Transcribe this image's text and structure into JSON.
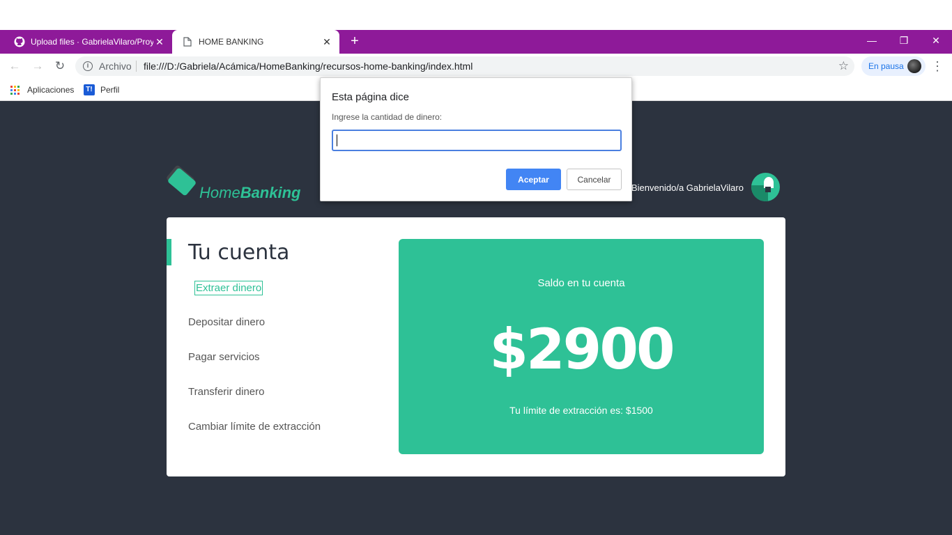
{
  "browser": {
    "tabs": [
      {
        "title": "Upload files · GabrielaVilaro/Proy",
        "icon": "github-icon",
        "active": false
      },
      {
        "title": "HOME BANKING",
        "icon": "page-icon",
        "active": true
      }
    ],
    "new_tab": "+",
    "address": {
      "scheme_label": "Archivo",
      "url": "file:///D:/Gabriela/Acámica/HomeBanking/recursos-home-banking/index.html"
    },
    "profile_status": "En pausa",
    "bookmarks": [
      {
        "label": "Aplicaciones",
        "icon": "apps-grid-icon"
      },
      {
        "label": "Perfil",
        "icon": "trello-icon"
      }
    ],
    "tab_color": "#8e1a99"
  },
  "dialog": {
    "title": "Esta página dice",
    "message": "Ingrese la cantidad de dinero:",
    "input_value": "",
    "ok_label": "Aceptar",
    "cancel_label": "Cancelar"
  },
  "app": {
    "logo": {
      "part1": "Home",
      "part2": "Banking"
    },
    "welcome": "Bienvenido/a GabrielaVilaro",
    "section_title": "Tu cuenta",
    "menu": [
      {
        "label": "Extraer dinero",
        "selected": true
      },
      {
        "label": "Depositar dinero",
        "selected": false
      },
      {
        "label": "Pagar servicios",
        "selected": false
      },
      {
        "label": "Transferir dinero",
        "selected": false
      },
      {
        "label": "Cambiar límite de extracción",
        "selected": false
      }
    ],
    "balance_label": "Saldo en tu cuenta",
    "balance_value": "$2900",
    "limit_text": "Tu límite de extracción es: $1500",
    "accent_color": "#2ec196",
    "background_color": "#2c333f"
  }
}
